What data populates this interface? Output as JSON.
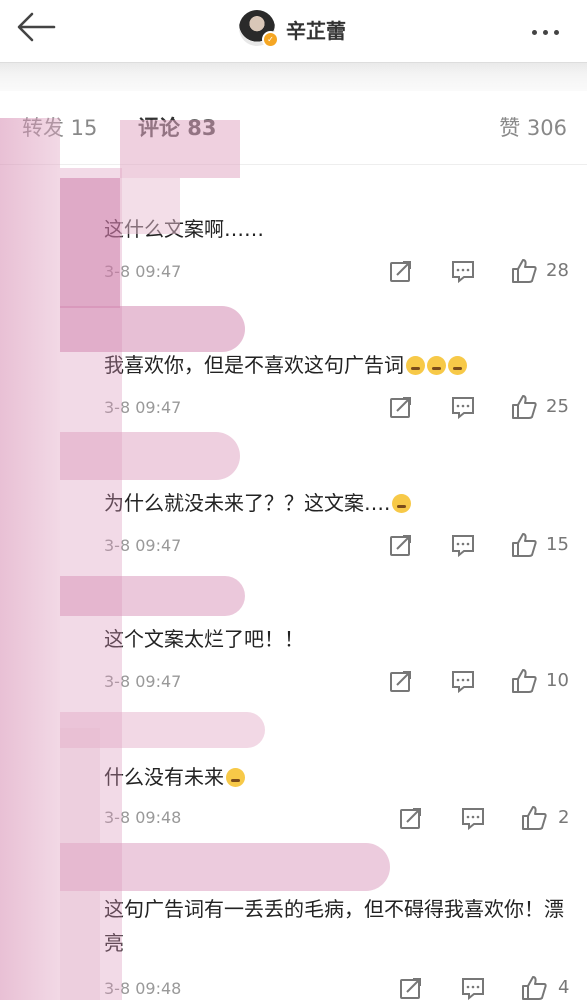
{
  "header": {
    "user_name": "辛芷蕾",
    "back_icon": "arrow-left-icon",
    "more_icon": "more-dots-icon"
  },
  "tabs": {
    "repost": "转发 15",
    "comments": "评论 83",
    "likes": "赞 306"
  },
  "comments": [
    {
      "text": "这什么文案啊……",
      "time": "3-8 09:47",
      "likes": "28"
    },
    {
      "text": "我喜欢你，但是不喜欢这句广告词",
      "emoji_count": 3,
      "time": "3-8 09:47",
      "likes": "25"
    },
    {
      "text": "为什么就没未来了？？这文案….",
      "emoji_count": 1,
      "time": "3-8 09:47",
      "likes": "15"
    },
    {
      "text": "这个文案太烂了吧！！",
      "time": "3-8 09:47",
      "likes": "10"
    },
    {
      "text": "什么没有未来",
      "emoji_count": 1,
      "time": "3-8 09:48",
      "likes": "2"
    },
    {
      "text": "这句广告词有一丢丢的毛病，但不碍得我喜欢你！漂亮",
      "time": "3-8 09:48",
      "likes": "4"
    }
  ],
  "colors": {
    "blur_pink": "#d98fb4",
    "accent": "#f5a623"
  }
}
